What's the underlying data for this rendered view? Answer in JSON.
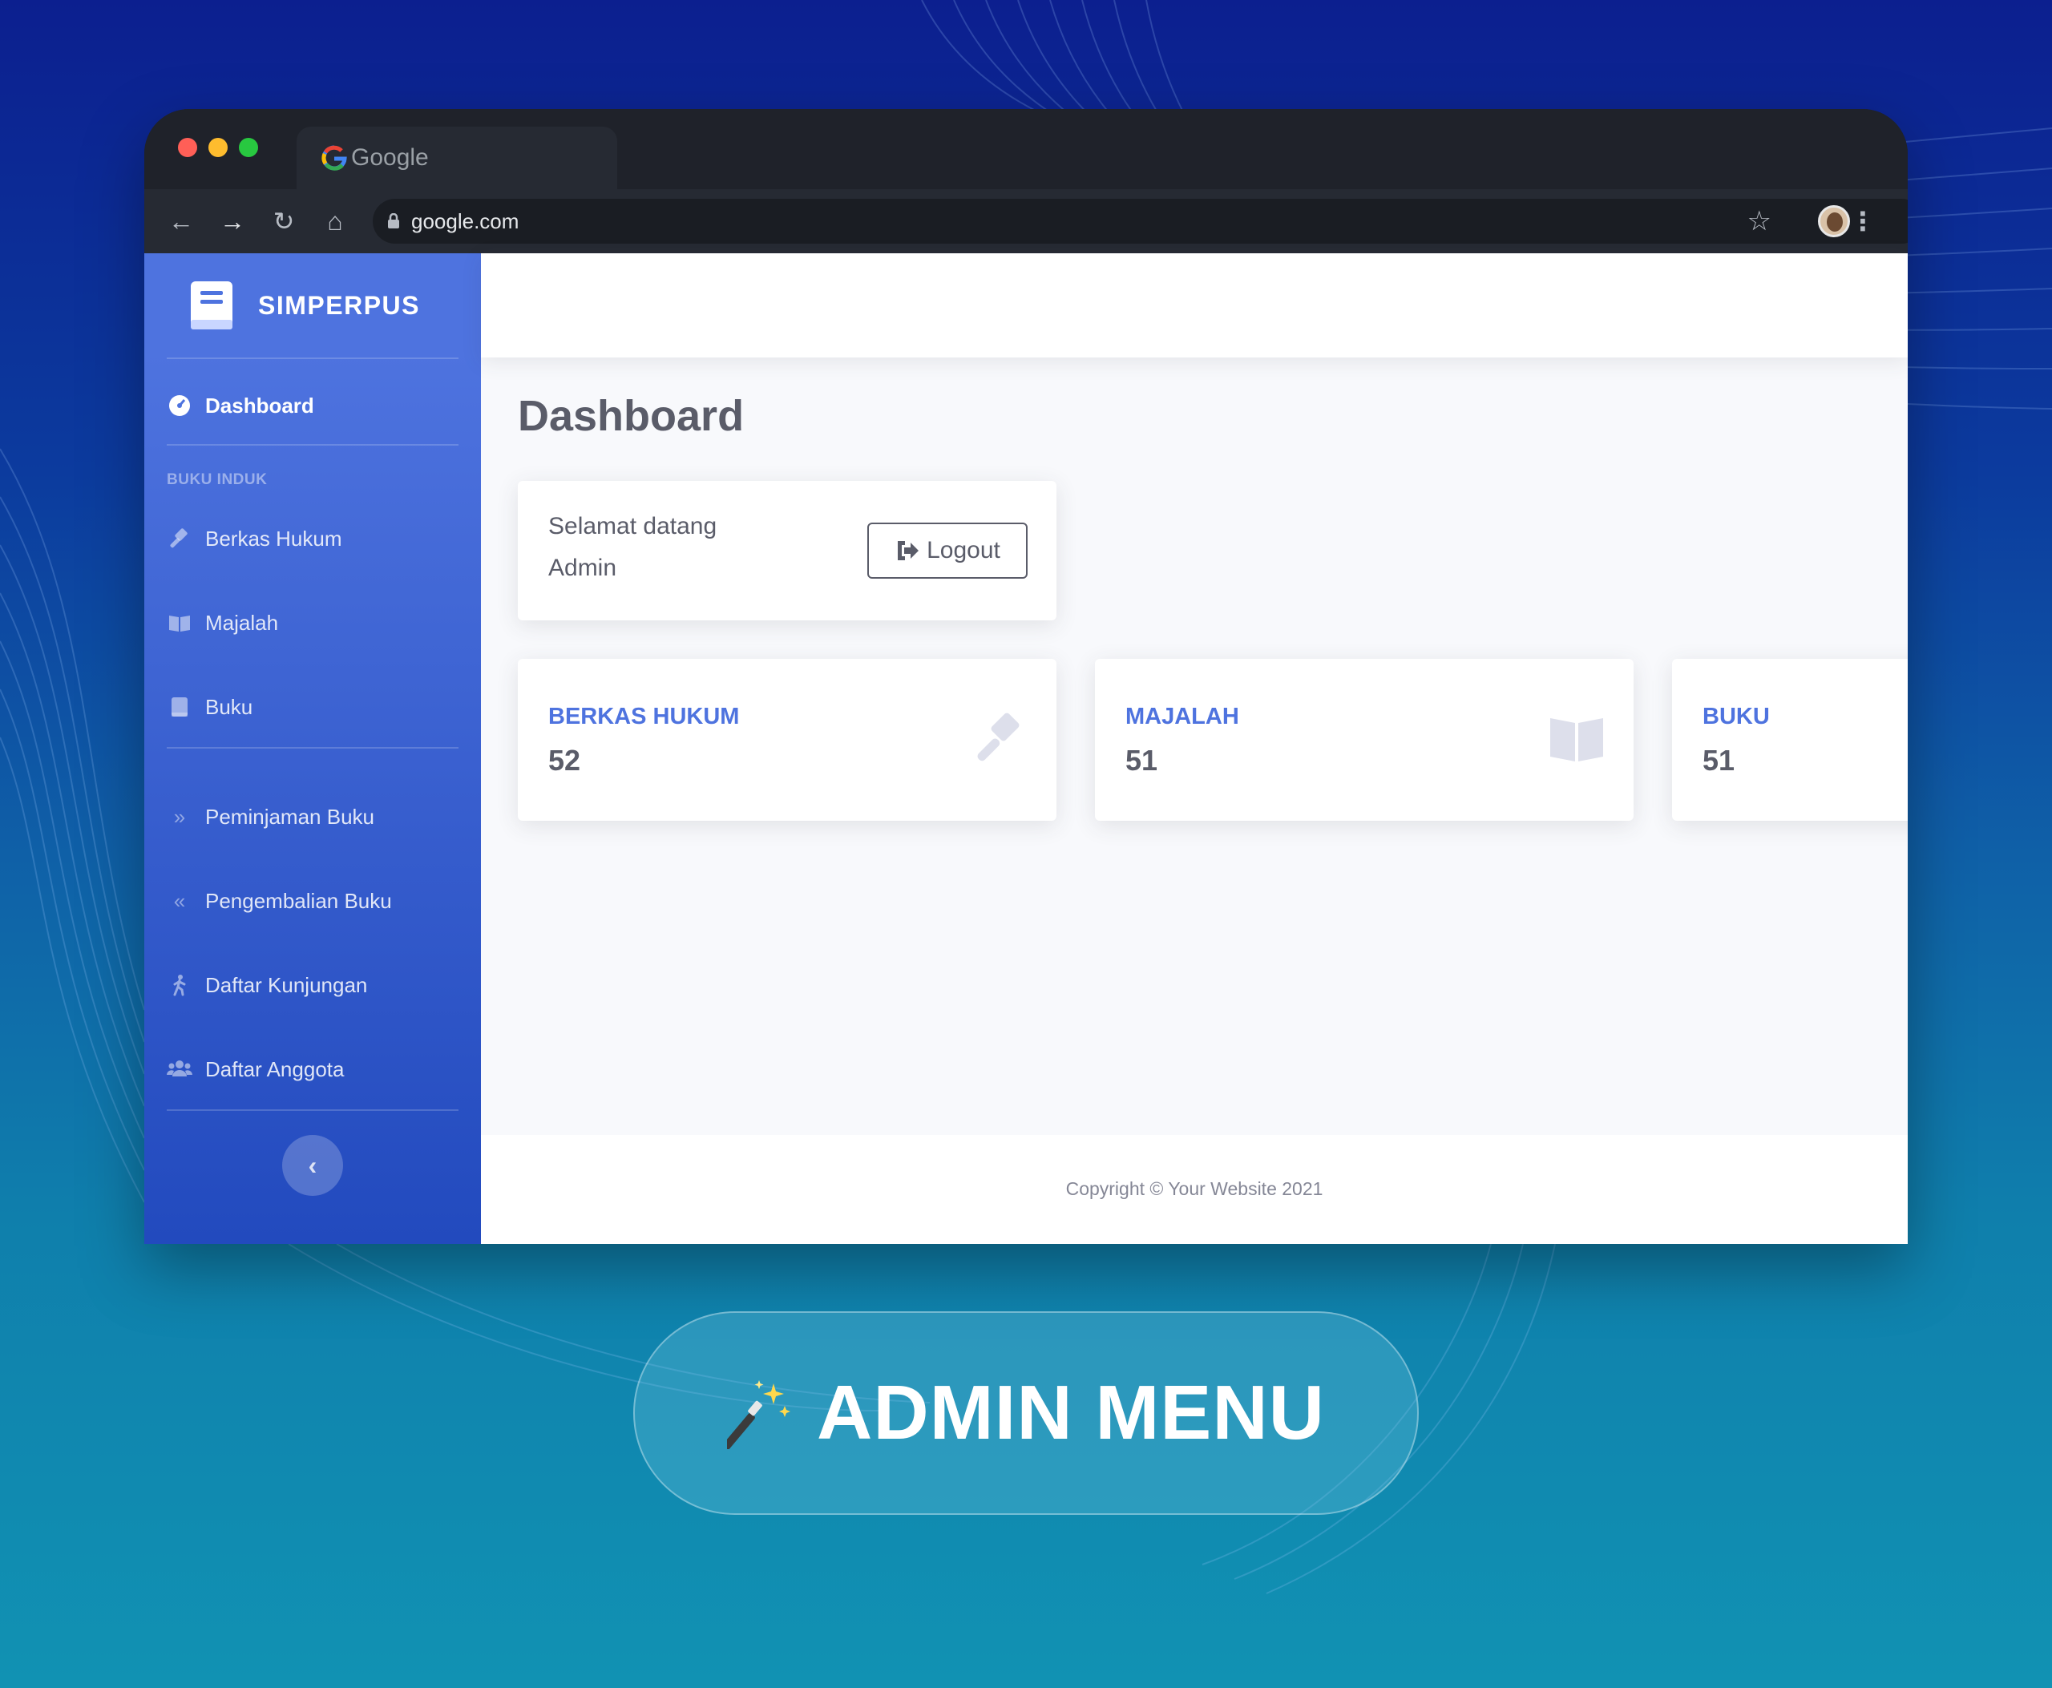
{
  "browser": {
    "tab_title": "Google",
    "address": "google.com"
  },
  "sidebar": {
    "brand": "SIMPERPUS",
    "items": [
      {
        "label": "Dashboard",
        "icon": "tachometer-icon",
        "active": true
      },
      {
        "label": "Berkas Hukum",
        "icon": "gavel-icon"
      },
      {
        "label": "Majalah",
        "icon": "book-open-icon"
      },
      {
        "label": "Buku",
        "icon": "book-icon"
      },
      {
        "label": "Peminjaman Buku",
        "icon": "double-chevron-right-icon"
      },
      {
        "label": "Pengembalian Buku",
        "icon": "double-chevron-left-icon"
      },
      {
        "label": "Daftar Kunjungan",
        "icon": "walking-icon"
      },
      {
        "label": "Daftar Anggota",
        "icon": "users-icon"
      }
    ],
    "heading": "BUKU INDUK"
  },
  "main": {
    "page_title": "Dashboard",
    "welcome": {
      "line1": "Selamat datang",
      "line2": "Admin",
      "logout_label": "Logout"
    },
    "stats": [
      {
        "title": "BERKAS HUKUM",
        "value": "52",
        "icon": "gavel-icon"
      },
      {
        "title": "MAJALAH",
        "value": "51",
        "icon": "book-open-icon"
      },
      {
        "title": "BUKU",
        "value": "51",
        "icon": "book-icon"
      }
    ],
    "footer": "Copyright © Your Website 2021"
  },
  "caption": {
    "text": "ADMIN MENU",
    "icon": "magic-wand-icon"
  },
  "colors": {
    "primary": "#4e73df",
    "sidebar_end": "#224abe",
    "text": "#5a5c69"
  }
}
